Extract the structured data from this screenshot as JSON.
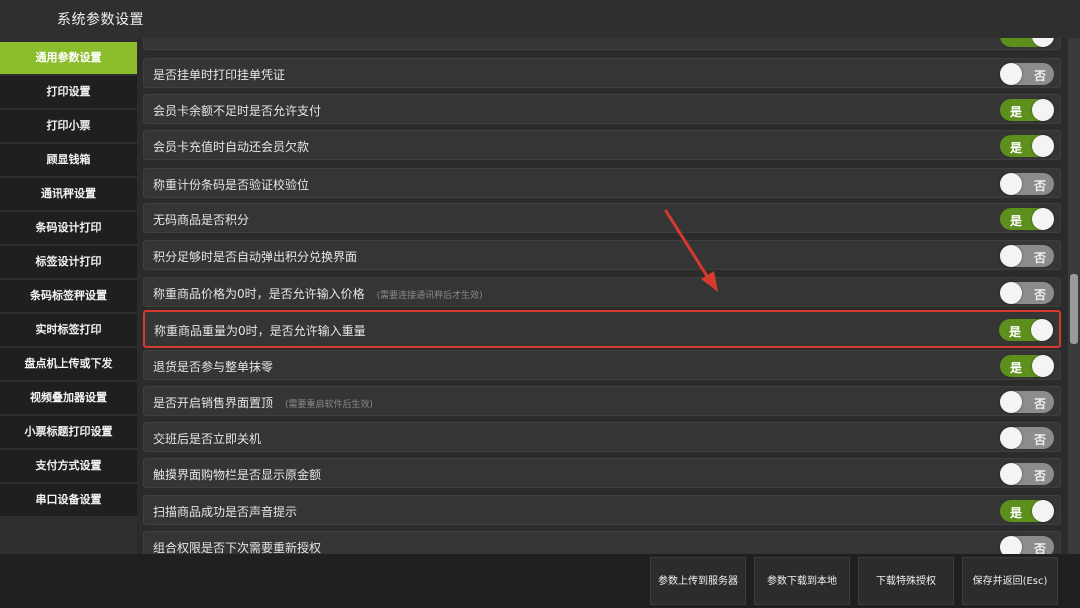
{
  "window": {
    "title": "系统参数设置"
  },
  "sidebar": {
    "items": [
      {
        "label": "通用参数设置",
        "active": true
      },
      {
        "label": "打印设置"
      },
      {
        "label": "打印小票"
      },
      {
        "label": "顾显钱箱"
      },
      {
        "label": "通讯秤设置"
      },
      {
        "label": "条码设计打印"
      },
      {
        "label": "标签设计打印"
      },
      {
        "label": "条码标签秤设置"
      },
      {
        "label": "实时标签打印"
      },
      {
        "label": "盘点机上传或下发"
      },
      {
        "label": "视频叠加器设置"
      },
      {
        "label": "小票标题打印设置"
      },
      {
        "label": "支付方式设置"
      },
      {
        "label": "串口设备设置"
      }
    ]
  },
  "toggle_labels": {
    "on": "是",
    "off": "否"
  },
  "settings": [
    {
      "label": "是否挂单时打印挂单凭证",
      "on": false
    },
    {
      "label": "会员卡余额不足时是否允许支付",
      "on": true
    },
    {
      "label": "会员卡充值时自动还会员欠款",
      "on": true
    },
    {
      "label": "称重计份条码是否验证校验位",
      "on": false
    },
    {
      "label": "无码商品是否积分",
      "on": true
    },
    {
      "label": "积分足够时是否自动弹出积分兑换界面",
      "on": false
    },
    {
      "label": "称重商品价格为0时，是否允许输入价格",
      "note": "(需要连接通讯秤后才生效)",
      "on": false
    },
    {
      "label": "称重商品重量为0时，是否允许输入重量",
      "on": true,
      "highlighted": true
    },
    {
      "label": "退货是否参与整单抹零",
      "on": true
    },
    {
      "label": "是否开启销售界面置顶",
      "note": "(需要重启软件后生效)",
      "on": false
    },
    {
      "label": "交班后是否立即关机",
      "on": false
    },
    {
      "label": "触摸界面购物栏是否显示原金额",
      "on": false
    },
    {
      "label": "扫描商品成功是否声音提示",
      "on": true
    },
    {
      "label": "组合权限是否下次需要重新授权",
      "on": false
    }
  ],
  "footer": {
    "buttons": [
      {
        "label": "参数上传到服务器"
      },
      {
        "label": "参数下载到本地"
      },
      {
        "label": "下载特殊授权"
      },
      {
        "label": "保存并返回(Esc)"
      }
    ]
  },
  "colors": {
    "accent": "#8bbd2c",
    "toggle_on": "#5d8f1d",
    "toggle_off": "#8c8c8c",
    "highlight": "#d63a2f"
  }
}
